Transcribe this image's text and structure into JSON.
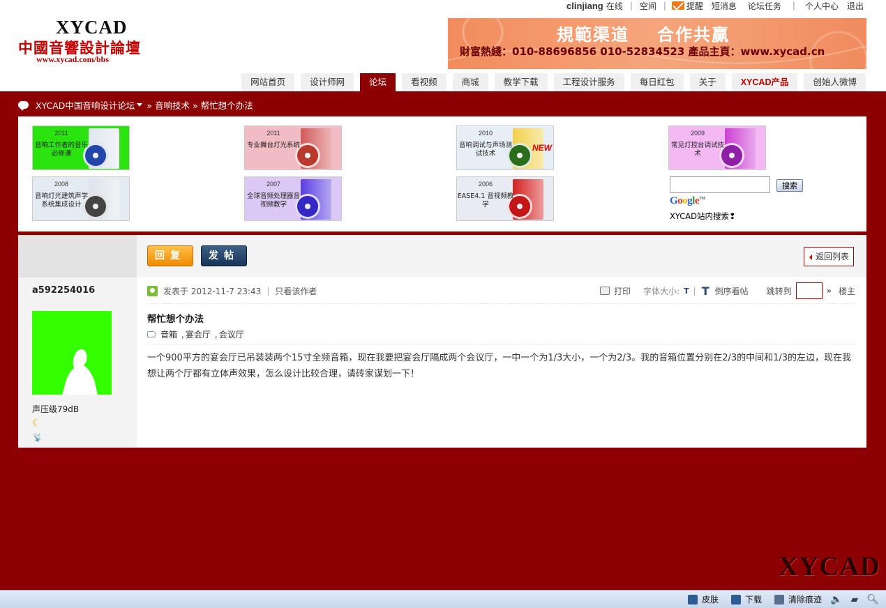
{
  "toplinks": {
    "username": "clinjiang",
    "status": "在线",
    "space": "空间",
    "remind": "提醒",
    "messages": "短消息",
    "tasks": "论坛任务",
    "profile": "个人中心",
    "logout": "退出"
  },
  "logo": {
    "en": "XYCAD",
    "cn": "中國音響設計論壇",
    "url": "www.xycad.com/bbs"
  },
  "banner": {
    "slogan1": "規範渠道",
    "slogan2": "合作共贏",
    "contact": "財富熱綫：010-88696856  010-52834523  產品主頁：www.xycad.cn"
  },
  "nav": [
    {
      "label": "网站首页",
      "active": false
    },
    {
      "label": "设计师网",
      "active": false
    },
    {
      "label": "论坛",
      "active": true
    },
    {
      "label": "看视频",
      "active": false
    },
    {
      "label": "商城",
      "active": false
    },
    {
      "label": "教学下载",
      "active": false
    },
    {
      "label": "工程设计服务",
      "active": false
    },
    {
      "label": "每日红包",
      "active": false
    },
    {
      "label": "关于",
      "active": false
    },
    {
      "label": "XYCAD产品",
      "active": false
    },
    {
      "label": "创始人微博",
      "active": false
    }
  ],
  "breadcrumb": {
    "forum": "XYCAD中国音响设计论坛",
    "section": "» 音响技术",
    "topic": "» 帮忙想个办法"
  },
  "products": [
    {
      "year": "2011",
      "title": "音响工作者的音乐必修课",
      "bg": "#2be40f",
      "box": "#dfe6ee",
      "disc": "#2247a8"
    },
    {
      "year": "2011",
      "title": "专业舞台灯光系统",
      "bg": "#f1bcc4",
      "box": "#d25a5a",
      "disc": "#b83a2c"
    },
    {
      "year": "2010",
      "title": "音响调试与声场测试技术",
      "bg": "#e6eef6",
      "box": "#f2d04a",
      "disc": "#2a6e1b"
    },
    {
      "year": "2009",
      "title": "常见灯控台调试技术",
      "bg": "#f4b8f2",
      "box": "#cc3fd4",
      "disc": "#8f1fa6"
    },
    {
      "year": "2008",
      "title": "音响灯光建筑声学系统集成设计",
      "bg": "#e4ebf3",
      "box": "#dde3ea",
      "disc": "#444"
    },
    {
      "year": "2007",
      "title": "全球音频处理器音视频教学",
      "bg": "#dcc8f4",
      "box": "#5a3de0",
      "disc": "#3528c4"
    },
    {
      "year": "2006",
      "title": "EASE4.1 音视频教学",
      "bg": "#e8ecf2",
      "box": "#d42020",
      "disc": "#c31616"
    }
  ],
  "search": {
    "button": "搜索",
    "google": "Google",
    "site_search": "XYCAD站内搜索❢"
  },
  "postbar": {
    "reply": "回复",
    "new_post": "发帖",
    "back": "返回列表"
  },
  "author": {
    "name": "a592254016",
    "rank": "声压级79dB"
  },
  "post": {
    "posted_at": "发表于 2012-11-7 23:43",
    "only_author": "只看该作者",
    "print": "打印",
    "font_size": "字体大小:",
    "font_t": "T",
    "reverse": "倒序看帖",
    "jump": "跳转到",
    "floor": "楼主",
    "title": "帮忙想个办法",
    "tags": [
      "音箱",
      "宴会厅",
      "会议厅"
    ],
    "content": "一个900平方的宴会厅已吊装装两个15寸全频音箱，现在我要把宴会厅隔成两个会议厅，一中一个为1/3大小，一个为2/3。我的音箱位置分别在2/3的中间和1/3的左边，现在我想让两个厅都有立体声效果，怎么设计比较合理，请砖家谋划一下！"
  },
  "corner_logo": "XYCAD",
  "statusbar": {
    "skin": "皮肤",
    "download": "下载",
    "clear": "清除痕迹"
  }
}
